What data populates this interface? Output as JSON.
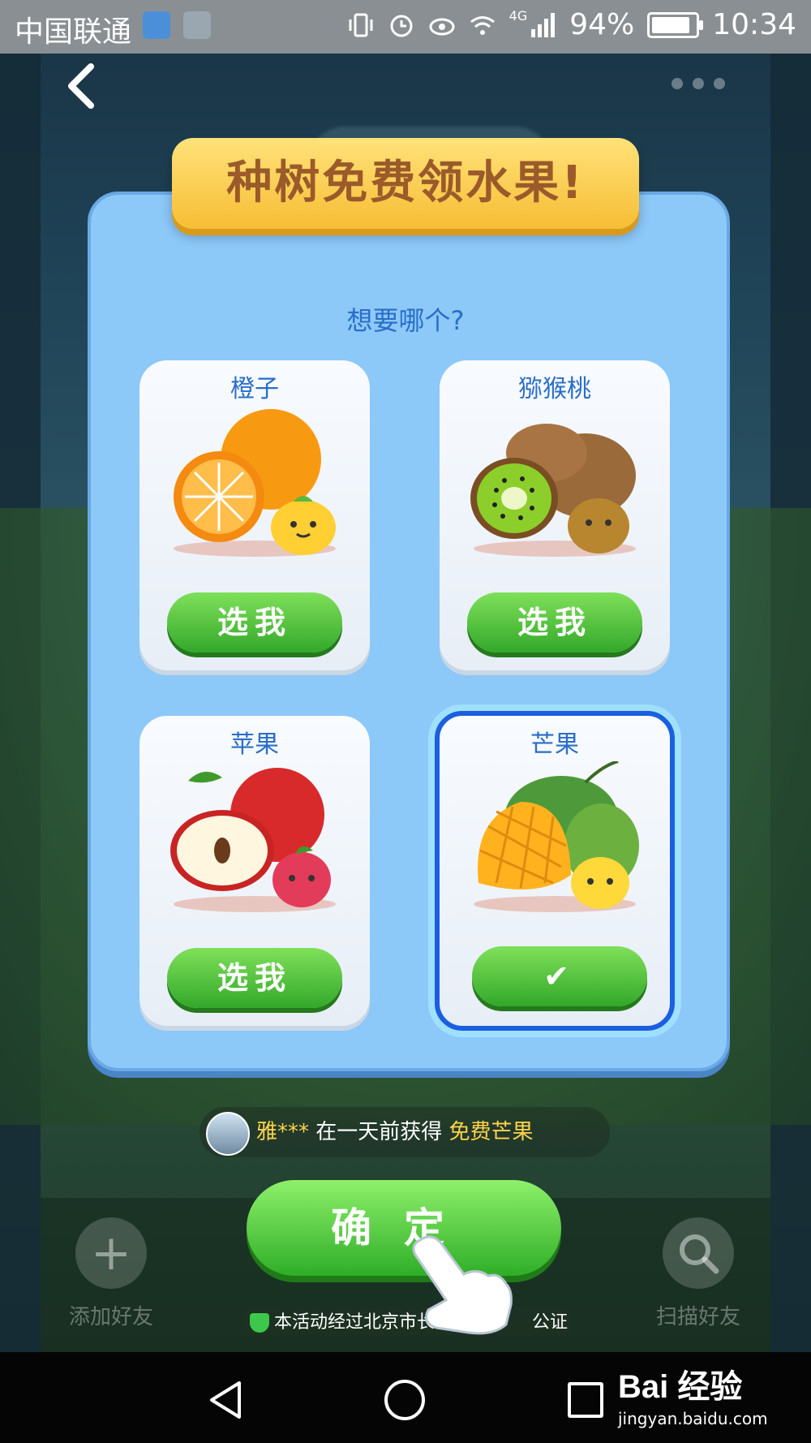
{
  "status_bar": {
    "carrier": "中国联通",
    "network": "4G",
    "battery": "94%",
    "time": "10:34"
  },
  "header": {
    "back_icon": "chevron-left-icon",
    "more_icon": "more-dots-icon"
  },
  "banner": {
    "title": "种树免费领水果!"
  },
  "subtitle": "想要哪个?",
  "fruits": [
    {
      "name": "橙子",
      "button": "选我",
      "selected": false,
      "icon": "orange-fruit-icon"
    },
    {
      "name": "猕猴桃",
      "button": "选我",
      "selected": false,
      "icon": "kiwi-fruit-icon"
    },
    {
      "name": "苹果",
      "button": "选我",
      "selected": false,
      "icon": "apple-fruit-icon"
    },
    {
      "name": "芒果",
      "button": "✔",
      "selected": true,
      "icon": "mango-fruit-icon"
    }
  ],
  "feed": {
    "user": "雅***",
    "action": " 在一天前获得 ",
    "prize": "免费芒果"
  },
  "confirm_button": "确定",
  "certificate": "本活动经过北京市长",
  "certificate_tail": "公证",
  "dock": {
    "add_friend": "添加好友",
    "scan_friend": "扫描好友"
  },
  "watermark": {
    "logo": "Bai 经验",
    "url": "jingyan.baidu.com"
  },
  "colors": {
    "accent_blue": "#2a6ec9",
    "button_green": "#33a82a",
    "banner_gold": "#f7bd34",
    "selected_border": "#1a5fe0"
  }
}
